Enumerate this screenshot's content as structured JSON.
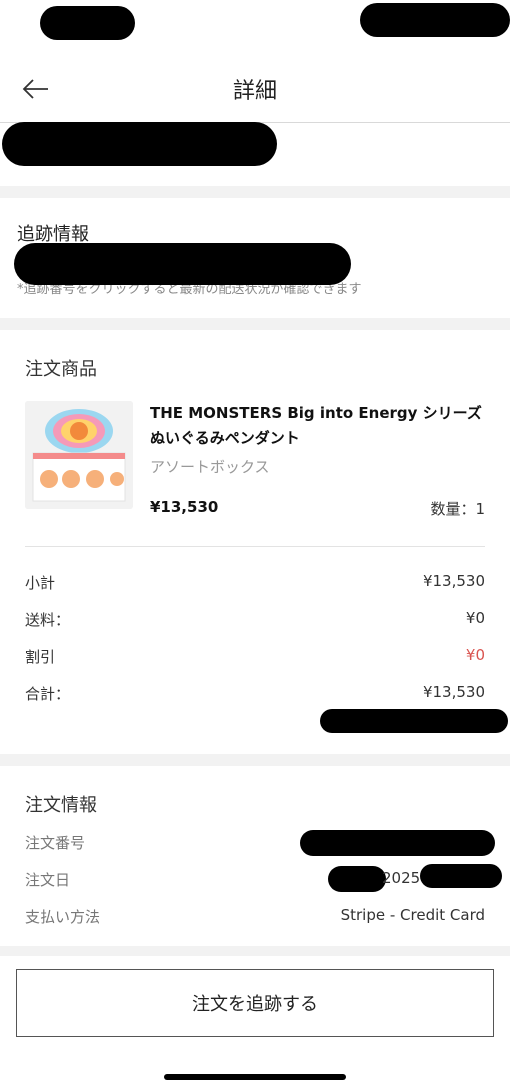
{
  "header": {
    "title": "詳細"
  },
  "tracking": {
    "title": "追跡情報",
    "note": "*追跡番号をクリックすると最新の配送状況が確認できます"
  },
  "order_items": {
    "title": "注文商品",
    "product": {
      "name": "THE MONSTERS Big into Energy シリーズ ぬいぐるみペンダント",
      "variant": "アソートボックス",
      "price": "¥13,530",
      "quantity": "数量：1"
    }
  },
  "summary": {
    "subtotal_label": "小計",
    "subtotal_value": "¥13,530",
    "shipping_label": "送料：",
    "shipping_value": "¥0",
    "discount_label": "割引",
    "discount_value": "¥0",
    "total_label": "合計：",
    "total_value": "¥13,530"
  },
  "order_info": {
    "title": "注文情報",
    "order_number_label": "注文番号",
    "order_date_label": "注文日",
    "order_date_partial": "2025",
    "payment_label": "支払い方法",
    "payment_value": "Stripe - Credit Card"
  },
  "actions": {
    "track_button_label": "注文を追跡する"
  },
  "colors": {
    "discount": "#d9534f",
    "separator": "#f2f2f2"
  }
}
